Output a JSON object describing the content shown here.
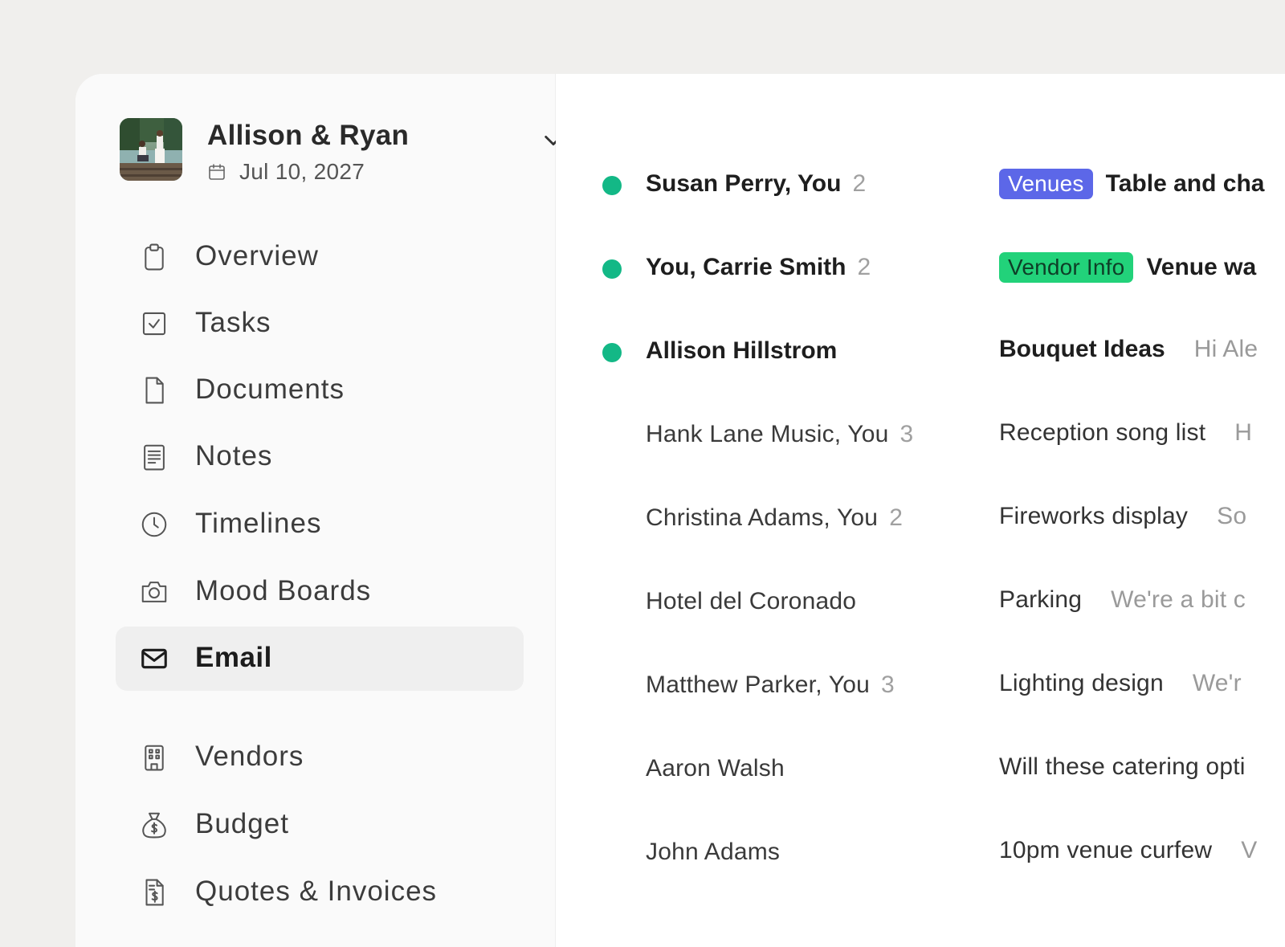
{
  "wedding": {
    "couple_name": "Allison & Ryan",
    "date": "Jul 10, 2027"
  },
  "colors": {
    "unread_dot": "#13b886",
    "tag_venues": "#5c67e8",
    "tag_vendor_info": "#22d27a",
    "active_nav_bg": "#efefef"
  },
  "nav": {
    "items": [
      {
        "label": "Overview",
        "icon": "clipboard-icon"
      },
      {
        "label": "Tasks",
        "icon": "checkbox-icon"
      },
      {
        "label": "Documents",
        "icon": "document-icon"
      },
      {
        "label": "Notes",
        "icon": "notes-icon"
      },
      {
        "label": "Timelines",
        "icon": "clock-icon"
      },
      {
        "label": "Mood Boards",
        "icon": "camera-icon"
      },
      {
        "label": "Email",
        "icon": "mail-icon",
        "active": true
      },
      {
        "label": "Vendors",
        "icon": "building-icon"
      },
      {
        "label": "Budget",
        "icon": "money-bag-icon"
      },
      {
        "label": "Quotes & Invoices",
        "icon": "invoice-icon"
      }
    ]
  },
  "threads": [
    {
      "participants": "Susan Perry, You",
      "count": "2",
      "tag": "Venues",
      "subject": "Table and cha",
      "preview": "",
      "unread": true
    },
    {
      "participants": "You, Carrie Smith",
      "count": "2",
      "tag": "Vendor Info",
      "subject": "Venue wa",
      "preview": "",
      "unread": true
    },
    {
      "participants": "Allison Hillstrom",
      "count": "",
      "tag": "",
      "subject": "Bouquet Ideas",
      "preview": "Hi Ale",
      "unread": true
    },
    {
      "participants": "Hank Lane Music, You",
      "count": "3",
      "tag": "",
      "subject": "Reception song list",
      "preview": "H",
      "unread": false
    },
    {
      "participants": "Christina Adams, You",
      "count": "2",
      "tag": "",
      "subject": "Fireworks display",
      "preview": "So",
      "unread": false
    },
    {
      "participants": "Hotel del Coronado",
      "count": "",
      "tag": "",
      "subject": "Parking",
      "preview": "We're a bit c",
      "unread": false
    },
    {
      "participants": "Matthew Parker, You",
      "count": "3",
      "tag": "",
      "subject": "Lighting design",
      "preview": "We'r",
      "unread": false
    },
    {
      "participants": "Aaron Walsh",
      "count": "",
      "tag": "",
      "subject": "Will these catering opti",
      "preview": "",
      "unread": false
    },
    {
      "participants": "John Adams",
      "count": "",
      "tag": "",
      "subject": "10pm venue curfew",
      "preview": "V",
      "unread": false
    }
  ]
}
